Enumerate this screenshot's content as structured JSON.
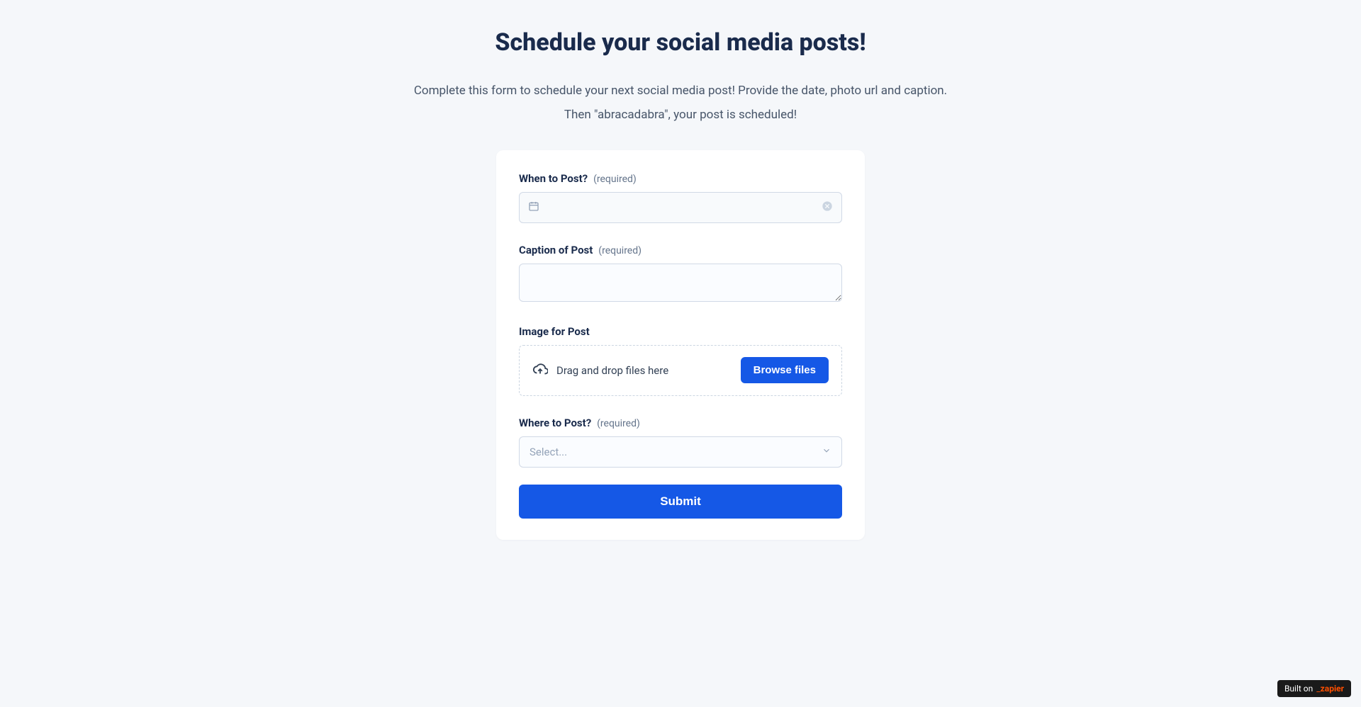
{
  "header": {
    "title": "Schedule your social media posts!",
    "description_line1": "Complete this form to schedule your next social media post! Provide the date, photo url and caption.",
    "description_line2": "Then \"abracadabra\", your post is scheduled!"
  },
  "form": {
    "fields": {
      "when": {
        "label": "When to Post?",
        "required_text": "(required)"
      },
      "caption": {
        "label": "Caption of Post",
        "required_text": "(required)"
      },
      "image": {
        "label": "Image for Post",
        "drop_text": "Drag and drop files here",
        "browse_label": "Browse files"
      },
      "where": {
        "label": "Where to Post?",
        "required_text": "(required)",
        "placeholder": "Select..."
      }
    },
    "submit_label": "Submit"
  },
  "badge": {
    "prefix": "Built on",
    "brand": "zapier"
  }
}
